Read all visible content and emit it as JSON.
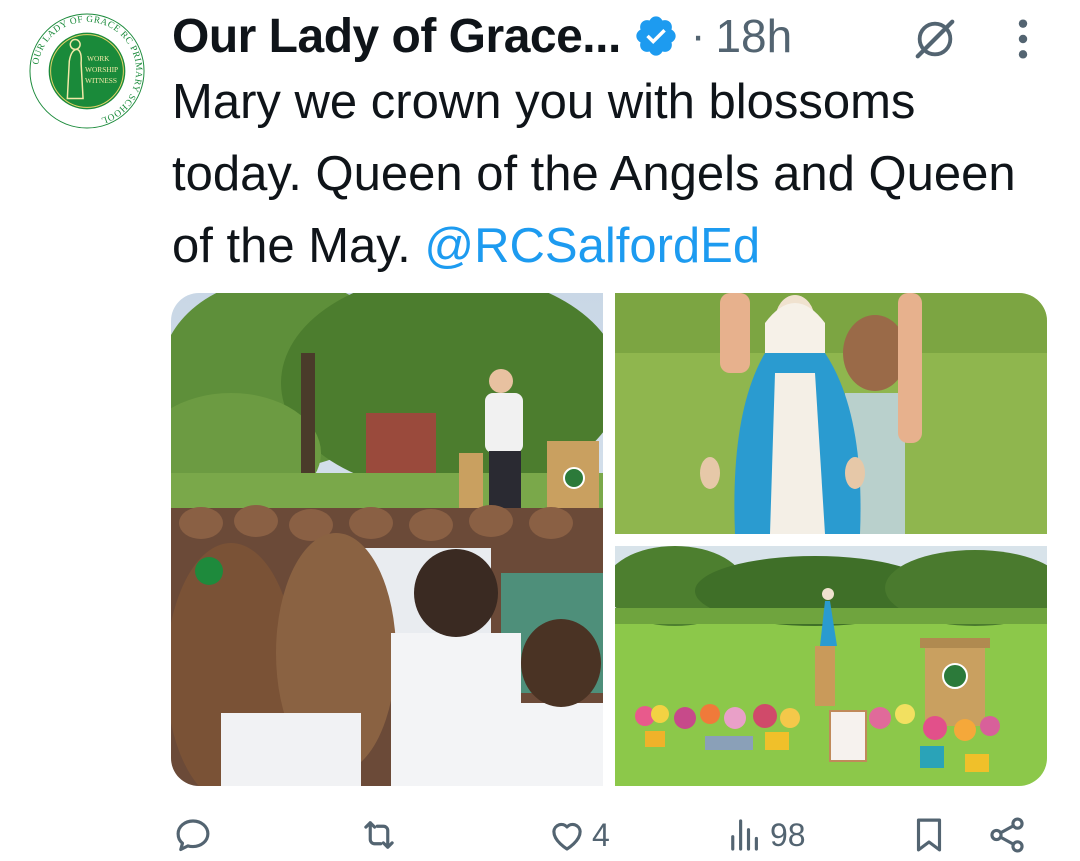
{
  "author": {
    "display_name": "Our Lady of Grace...",
    "verified": true,
    "badge_color": "#1d9bf0",
    "avatar": {
      "ring_text": "OUR LADY OF GRACE RC PRIMARY SCHOOL",
      "center_lines": [
        "WORK",
        "WORSHIP",
        "WITNESS"
      ],
      "color": "#1a8a3a"
    }
  },
  "meta": {
    "separator": "·",
    "time": "18h"
  },
  "tweet": {
    "text": "Mary we crown you with blossoms today. Queen of the Angels and Queen of the May. ",
    "mention": "@RCSalfordEd",
    "mention_color": "#1d9bf0"
  },
  "media": [
    {
      "name": "children-seated-outdoors-photo"
    },
    {
      "name": "mary-statue-held-photo"
    },
    {
      "name": "statue-and-flowers-on-field-photo"
    }
  ],
  "actions": {
    "reply": {
      "icon": "reply-icon",
      "count": ""
    },
    "retweet": {
      "icon": "retweet-icon",
      "count": ""
    },
    "like": {
      "icon": "heart-icon",
      "count": "4"
    },
    "views": {
      "icon": "views-icon",
      "count": "98"
    },
    "bookmark": {
      "icon": "bookmark-icon"
    },
    "share": {
      "icon": "share-icon"
    }
  },
  "icons": {
    "grok": "grok-icon",
    "more": "more-vertical-icon"
  }
}
